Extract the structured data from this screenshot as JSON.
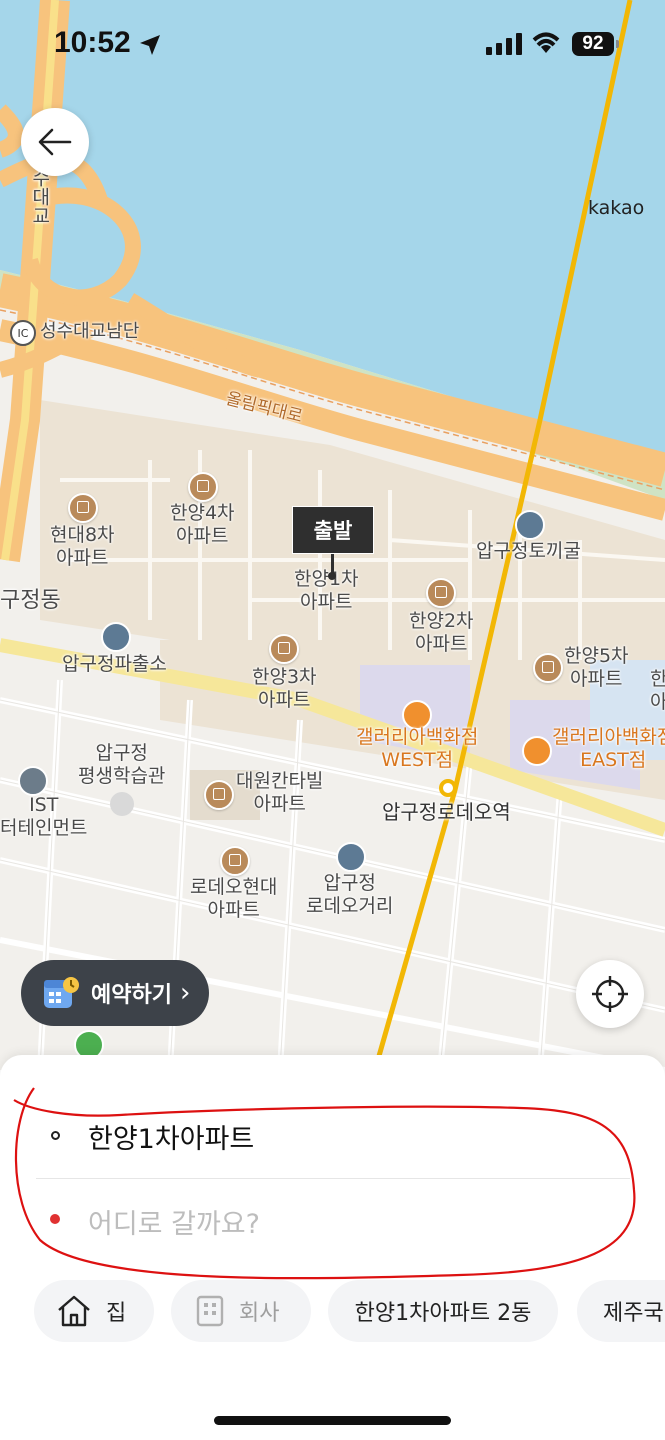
{
  "status_bar": {
    "time": "10:52",
    "battery": "92"
  },
  "map": {
    "attribution": "kakao",
    "labels": {
      "seongsu_bridge": "수대교",
      "ic_badge": "IC",
      "ic_name": "성수대교남단",
      "olympic_road": "올림픽대로",
      "hyundai8": "현대8차\n아파트",
      "hanyang4": "한양4차\n아파트",
      "hanyang1": "한양1차\n아파트",
      "hanyang2": "한양2차\n아파트",
      "hanyang3": "한양3차\n아파트",
      "hanyang5": "한양5차\n아파트",
      "apgujeong_dong": "구정동",
      "police": "압구정파출소",
      "tokkigul": "압구정토끼굴",
      "galleria_west": "갤러리아백화점\nWEST점",
      "galleria_east": "갤러리아백화점\nEAST점",
      "learning": "압구정\n평생학습관",
      "ist": "IST\n터테인먼트",
      "daewon": "대원칸타빌\n아파트",
      "rodeo_station": "압구정로데오역",
      "rodeo_hyundai": "로데오현대\n아파트",
      "rodeo_street": "압구정\n로데오거리",
      "edge_han": "한\n아"
    },
    "start_marker": "출발"
  },
  "buttons": {
    "reserve": "예약하기",
    "reserve_chevron": "›"
  },
  "route": {
    "origin": "한양1차아파트",
    "destination_placeholder": "어디로 갈까요?"
  },
  "shortcuts": [
    {
      "label": "집",
      "icon": "home-icon"
    },
    {
      "label": "회사",
      "icon": "office-icon"
    },
    {
      "label": "한양1차아파트 2동"
    },
    {
      "label": "제주국"
    }
  ]
}
